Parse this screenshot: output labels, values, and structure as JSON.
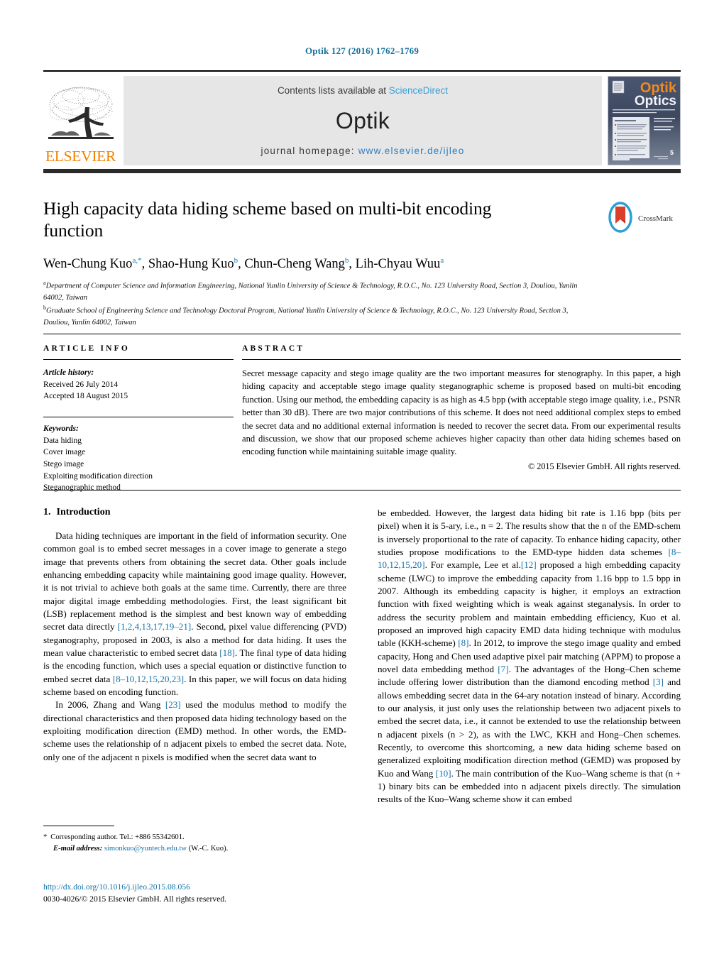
{
  "running_head": "Optik 127 (2016) 1762–1769",
  "masthead": {
    "elsevier_wordmark": "ELSEVIER",
    "contents_prefix": "Contents lists available at ",
    "contents_link": "ScienceDirect",
    "journal_name": "Optik",
    "homepage_prefix": "journal homepage: ",
    "homepage_url": "www.elsevier.de/ijleo",
    "cover": {
      "title_top": "Optik",
      "title_bottom": "Optics",
      "issue_number": "5"
    }
  },
  "title": "High capacity data hiding scheme based on multi-bit encoding function",
  "crossmark_label": "CrossMark",
  "authors": [
    {
      "name": "Wen-Chung Kuo",
      "marks": "a,*"
    },
    {
      "name": "Shao-Hung Kuo",
      "marks": "b"
    },
    {
      "name": "Chun-Cheng Wang",
      "marks": "b"
    },
    {
      "name": "Lih-Chyau Wuu",
      "marks": "a"
    }
  ],
  "affiliations": [
    {
      "mark": "a",
      "text": "Department of Computer Science and Information Engineering, National Yunlin University of Science & Technology, R.O.C., No. 123 University Road, Section 3, Douliou, Yunlin 64002, Taiwan"
    },
    {
      "mark": "b",
      "text": "Graduate School of Engineering Science and Technology Doctoral Program, National Yunlin University of Science & Technology, R.O.C., No. 123 University Road, Section 3, Douliou, Yunlin 64002, Taiwan"
    }
  ],
  "article_info": {
    "heading": "ARTICLE INFO",
    "history_label": "Article history:",
    "history": [
      "Received 26 July 2014",
      "Accepted 18 August 2015"
    ],
    "keywords_label": "Keywords:",
    "keywords": [
      "Data hiding",
      "Cover image",
      "Stego image",
      "Exploiting modification direction",
      "Steganographic method"
    ]
  },
  "abstract": {
    "heading": "ABSTRACT",
    "body": "Secret message capacity and stego image quality are the two important measures for stenography. In this paper, a high hiding capacity and acceptable stego image quality steganographic scheme is proposed based on multi-bit encoding function. Using our method, the embedding capacity is as high as 4.5 bpp (with acceptable stego image quality, i.e., PSNR better than 30 dB). There are two major contributions of this scheme. It does not need additional complex steps to embed the secret data and no additional external information is needed to recover the secret data. From our experimental results and discussion, we show that our proposed scheme achieves higher capacity than other data hiding schemes based on encoding function while maintaining suitable image quality.",
    "copyright": "© 2015 Elsevier GmbH. All rights reserved."
  },
  "section": {
    "number": "1.",
    "title": "Introduction"
  },
  "left_column": {
    "paragraph_1_a": "Data hiding techniques are important in the field of information security. One common goal is to embed secret messages in a cover image to generate a stego image that prevents others from obtaining the secret data. Other goals include enhancing embedding capacity while maintaining good image quality. However, it is not trivial to achieve both goals at the same time. Currently, there are three major digital image embedding methodologies. First, the least significant bit (LSB) replacement method is the simplest and best known way of embedding secret data directly ",
    "ref_1": "[1,2,4,13,17,19–21]",
    "paragraph_1_b": ". Second, pixel value differencing (PVD) steganography, proposed in 2003, is also a method for data hiding. It uses the mean value characteristic to embed secret data ",
    "ref_2": "[18]",
    "paragraph_1_c": ". The final type of data hiding is the encoding function, which uses a special equation or distinctive function to embed secret data ",
    "ref_3": "[8–10,12,15,20,23]",
    "paragraph_1_d": ". In this paper, we will focus on data hiding scheme based on encoding function.",
    "paragraph_2_a": "In 2006, Zhang and Wang ",
    "ref_4": "[23]",
    "paragraph_2_b": " used the modulus method to modify the directional characteristics and then proposed data hiding technology based on the exploiting modification direction (EMD) method. In other words, the EMD-scheme uses the relationship of n adjacent pixels to embed the secret data. Note, only one of the adjacent n pixels is modified when the secret data want to"
  },
  "right_column": {
    "paragraph_a": "be embedded. However, the largest data hiding bit rate is 1.16 bpp (bits per pixel) when it is 5-ary, i.e., n = 2. The results show that the n of the EMD-schem is inversely proportional to the rate of capacity. To enhance hiding capacity, other studies propose modifications to the EMD-type hidden data schemes ",
    "ref_1": "[8–10,12,15,20]",
    "paragraph_b": ". For example, Lee et al.",
    "ref_2": "[12]",
    "paragraph_c": " proposed a high embedding capacity scheme (LWC) to improve the embedding capacity from 1.16 bpp to 1.5 bpp in 2007. Although its embedding capacity is higher, it employs an extraction function with fixed weighting which is weak against steganalysis. In order to address the security problem and maintain embedding efficiency, Kuo et al. proposed an improved high capacity EMD data hiding technique with modulus table (KKH-scheme) ",
    "ref_3": "[8]",
    "paragraph_d": ". In 2012, to improve the stego image quality and embed capacity, Hong and Chen used adaptive pixel pair matching (APPM) to propose a novel data embedding method ",
    "ref_4": "[7]",
    "paragraph_e": ". The advantages of the Hong–Chen scheme include offering lower distribution than the diamond encoding method ",
    "ref_5": "[3]",
    "paragraph_f": " and allows embedding secret data in the 64-ary notation instead of binary. According to our analysis, it just only uses the relationship between two adjacent pixels to embed the secret data, i.e., it cannot be extended to use the relationship between n adjacent pixels (n > 2), as with the LWC, KKH and Hong–Chen schemes. Recently, to overcome this shortcoming, a new data hiding scheme based on generalized exploiting modification direction method (GEMD) was proposed by Kuo and Wang ",
    "ref_6": "[10]",
    "paragraph_g": ". The main contribution of the Kuo–Wang scheme is that (n + 1) binary bits can be embedded into n adjacent pixels directly. The simulation results of the Kuo–Wang scheme show it can embed"
  },
  "footnote": {
    "star": "*",
    "corresponding": "Corresponding author. Tel.: +886 55342601.",
    "email_label": "E-mail address:",
    "email": "simonkuo@yuntech.edu.tw",
    "email_suffix": "(W.-C. Kuo)."
  },
  "doi": {
    "url": "http://dx.doi.org/10.1016/j.ijleo.2015.08.056",
    "issn_line": "0030-4026/© 2015 Elsevier GmbH. All rights reserved."
  },
  "colors": {
    "link": "#1573a8",
    "sciencedirect": "#3aa0d8",
    "elsevier_orange": "#ef8200",
    "running_head": "#15719c"
  }
}
